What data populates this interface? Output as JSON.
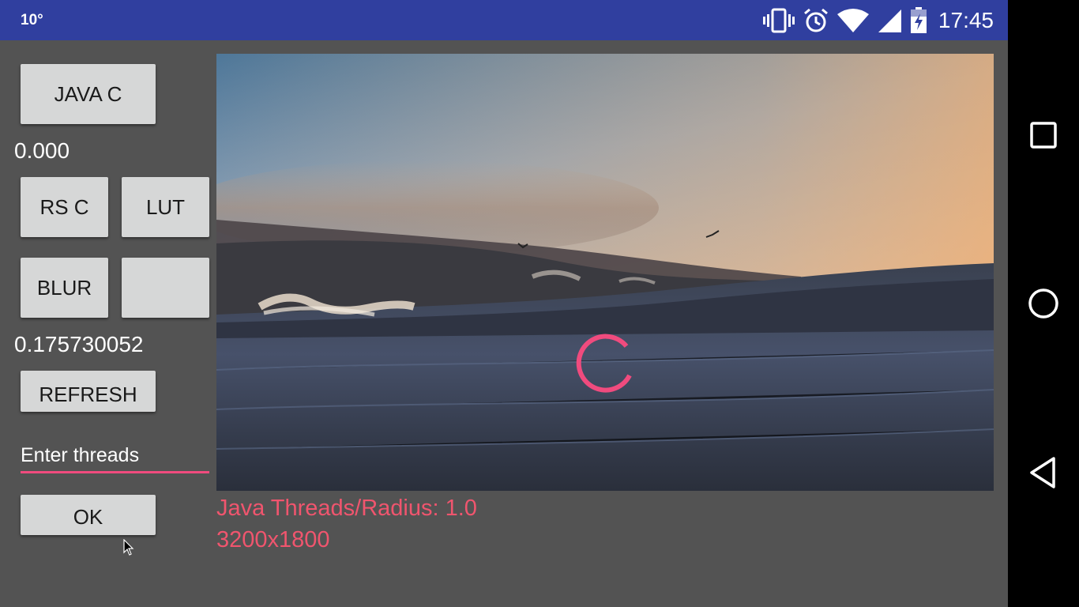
{
  "status_bar": {
    "temperature": "10°",
    "time": "17:45",
    "icons": [
      "vibrate-icon",
      "alarm-icon",
      "wifi-icon",
      "cell-signal-icon",
      "battery-charging-icon"
    ]
  },
  "controls": {
    "java_c_label": "JAVA C",
    "java_c_value": "0.000",
    "rs_c_label": "RS C",
    "lut_label": "LUT",
    "blur_label": "BLUR",
    "blank_label": "",
    "blur_value": "0.175730052",
    "refresh_label": "REFRESH",
    "threads_placeholder": "Enter threads",
    "threads_value": "",
    "ok_label": "OK"
  },
  "image": {
    "info_threads": "Java Threads/Radius: 1.0",
    "info_resolution": "3200x1800"
  },
  "colors": {
    "status_bar": "#303F9F",
    "background": "#535353",
    "button": "#D6D7D7",
    "accent": "#F04B7E",
    "info_text": "#F0556E"
  },
  "nav_bar": {
    "icons": [
      "recents-icon",
      "home-icon",
      "back-icon"
    ]
  }
}
